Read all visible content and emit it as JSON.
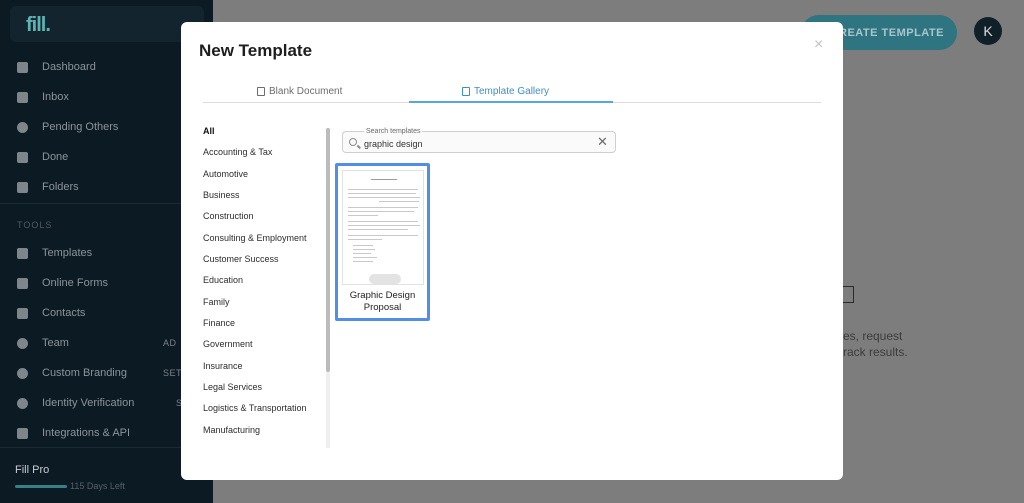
{
  "sidebar": {
    "logo": "fill.",
    "nav": [
      {
        "label": "Dashboard",
        "icon": "home-icon"
      },
      {
        "label": "Inbox",
        "icon": "inbox-icon"
      },
      {
        "label": "Pending Others",
        "icon": "users-icon"
      },
      {
        "label": "Done",
        "icon": "done-folder-icon"
      },
      {
        "label": "Folders",
        "icon": "folder-icon"
      }
    ],
    "tools_label": "TOOLS",
    "tools": [
      {
        "label": "Templates",
        "icon": "templates-icon",
        "suffix": ""
      },
      {
        "label": "Online Forms",
        "icon": "forms-icon",
        "suffix": ""
      },
      {
        "label": "Contacts",
        "icon": "contacts-icon",
        "suffix": ""
      },
      {
        "label": "Team",
        "icon": "team-icon",
        "suffix": "AD"
      },
      {
        "label": "Custom Branding",
        "icon": "palette-icon",
        "suffix": "SET"
      },
      {
        "label": "Identity Verification",
        "icon": "fingerprint-icon",
        "suffix": "SET"
      },
      {
        "label": "Integrations & API",
        "icon": "integrations-icon",
        "suffix": ""
      }
    ],
    "plan_name": "Fill Pro",
    "plan_days": "115 Days Left"
  },
  "background": {
    "create_button": "CREATE TEMPLATE",
    "avatar_initial": "K",
    "text_line1": "es, request",
    "text_line2": "rack results."
  },
  "modal": {
    "title": "New Template",
    "close_label": "×",
    "tabs": [
      {
        "label": "Blank Document",
        "icon": "document-icon"
      },
      {
        "label": "Template Gallery",
        "icon": "gallery-icon"
      }
    ],
    "categories": [
      "All",
      "Accounting & Tax",
      "Automotive",
      "Business",
      "Construction",
      "Consulting & Employment",
      "Customer Success",
      "Education",
      "Family",
      "Finance",
      "Government",
      "Insurance",
      "Legal Services",
      "Logistics & Transportation",
      "Manufacturing"
    ],
    "search": {
      "label": "Search templates",
      "value": "graphic design",
      "clear": "✕"
    },
    "results": [
      {
        "title": "Graphic Design Proposal"
      }
    ]
  },
  "colors": {
    "sidebar_bg": "#0c1a24",
    "accent_blue": "#3d8fc6",
    "card_border": "#4f8fe6",
    "teal": "#2e7481"
  }
}
